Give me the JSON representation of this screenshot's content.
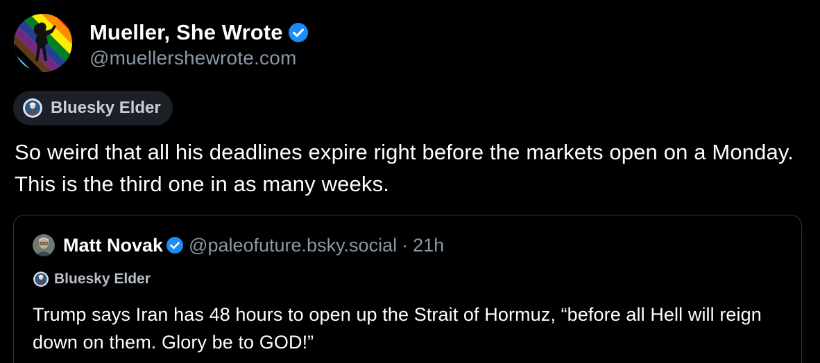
{
  "post": {
    "author": {
      "display_name": "Mueller, She Wrote",
      "handle": "@muellershewrote.com",
      "verified": true,
      "avatar_icon": "rainbow-silhouette-avatar"
    },
    "badge": {
      "label": "Bluesky Elder",
      "icon": "elder-badge-icon"
    },
    "text": "So weird that all his deadlines expire right before the markets open on a Monday. This is the third one in as many weeks."
  },
  "quote": {
    "author": {
      "display_name": "Matt Novak",
      "handle": "@paleofuture.bsky.social",
      "verified": true,
      "avatar_icon": "profile-photo-avatar"
    },
    "separator": "·",
    "timestamp": "21h",
    "badge": {
      "label": "Bluesky Elder",
      "icon": "elder-badge-icon"
    },
    "text": "Trump says Iran has 48 hours to open up the Strait of Hormuz, “before all Hell will reign down on them. Glory be to GOD!”"
  },
  "colors": {
    "background": "#000000",
    "text": "#ffffff",
    "secondary_text": "#8b98a5",
    "verified_blue": "#1d8cf8",
    "badge_bg": "#1b2027",
    "card_border": "#303741"
  }
}
